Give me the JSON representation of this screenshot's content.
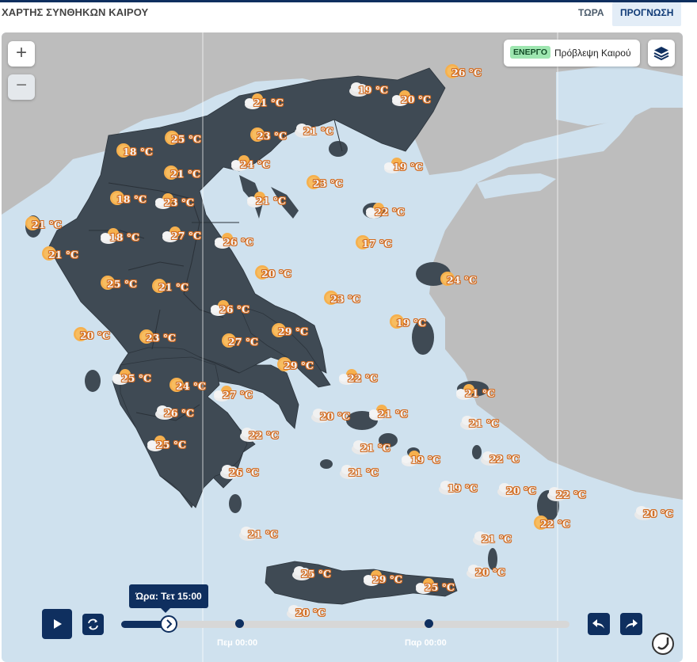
{
  "header": {
    "title": "ΧΑΡΤΗΣ ΣΥΝΘΗΚΩΝ ΚΑΙΡΟΥ",
    "tabs": [
      {
        "label": "ΤΩΡΑ",
        "active": false
      },
      {
        "label": "ΠΡΟΓΝΩΣΗ",
        "active": true
      }
    ]
  },
  "map_controls": {
    "zoom_in": "+",
    "zoom_out": "−",
    "layer": {
      "status_badge": "ΕΝΕΡΓΟ",
      "name": "Πρόβλεψη Καιρού"
    },
    "layers_icon": "layers-icon"
  },
  "markers": [
    {
      "temp": "26 °C",
      "icon": "sun"
    },
    {
      "temp": "19 °C",
      "icon": "cloud"
    },
    {
      "temp": "20 °C",
      "icon": "partly-cloudy"
    },
    {
      "temp": "21 °C",
      "icon": "partly-cloudy"
    },
    {
      "temp": "21 °C",
      "icon": "cloud"
    },
    {
      "temp": "23 °C",
      "icon": "sun"
    },
    {
      "temp": "25 °C",
      "icon": "sun"
    },
    {
      "temp": "18 °C",
      "icon": "sun"
    },
    {
      "temp": "21 °C",
      "icon": "sun"
    },
    {
      "temp": "24 °C",
      "icon": "partly-cloudy"
    },
    {
      "temp": "19 °C",
      "icon": "partly-cloudy"
    },
    {
      "temp": "23 °C",
      "icon": "sun"
    },
    {
      "temp": "18 °C",
      "icon": "sun"
    },
    {
      "temp": "23 °C",
      "icon": "partly-cloudy"
    },
    {
      "temp": "21 °C",
      "icon": "partly-cloudy"
    },
    {
      "temp": "22 °C",
      "icon": "partly-cloudy"
    },
    {
      "temp": "21 °C",
      "icon": "sun"
    },
    {
      "temp": "18 °C",
      "icon": "partly-cloudy"
    },
    {
      "temp": "27 °C",
      "icon": "partly-cloudy"
    },
    {
      "temp": "26 °C",
      "icon": "partly-cloudy"
    },
    {
      "temp": "17 °C",
      "icon": "sun"
    },
    {
      "temp": "21 °C",
      "icon": "sun"
    },
    {
      "temp": "20 °C",
      "icon": "sun"
    },
    {
      "temp": "24 °C",
      "icon": "sun"
    },
    {
      "temp": "25 °C",
      "icon": "sun"
    },
    {
      "temp": "21 °C",
      "icon": "sun"
    },
    {
      "temp": "23 °C",
      "icon": "sun"
    },
    {
      "temp": "26 °C",
      "icon": "partly-cloudy"
    },
    {
      "temp": "19 °C",
      "icon": "sun"
    },
    {
      "temp": "20 °C",
      "icon": "sun"
    },
    {
      "temp": "23 °C",
      "icon": "sun"
    },
    {
      "temp": "27 °C",
      "icon": "sun"
    },
    {
      "temp": "29 °C",
      "icon": "sun"
    },
    {
      "temp": "29 °C",
      "icon": "sun"
    },
    {
      "temp": "22 °C",
      "icon": "partly-cloudy"
    },
    {
      "temp": "25 °C",
      "icon": "partly-cloudy"
    },
    {
      "temp": "24 °C",
      "icon": "sun"
    },
    {
      "temp": "21 °C",
      "icon": "partly-cloudy"
    },
    {
      "temp": "27 °C",
      "icon": "partly-cloudy"
    },
    {
      "temp": "26 °C",
      "icon": "cloud"
    },
    {
      "temp": "20 °C",
      "icon": "cloud"
    },
    {
      "temp": "21 °C",
      "icon": "partly-cloudy"
    },
    {
      "temp": "21 °C",
      "icon": "cloud"
    },
    {
      "temp": "22 °C",
      "icon": "cloud"
    },
    {
      "temp": "25 °C",
      "icon": "partly-cloudy"
    },
    {
      "temp": "21 °C",
      "icon": "cloud"
    },
    {
      "temp": "19 °C",
      "icon": "partly-cloudy"
    },
    {
      "temp": "22 °C",
      "icon": "cloud"
    },
    {
      "temp": "21 °C",
      "icon": "cloud"
    },
    {
      "temp": "26 °C",
      "icon": "cloud"
    },
    {
      "temp": "19 °C",
      "icon": "cloud"
    },
    {
      "temp": "20 °C",
      "icon": "cloud"
    },
    {
      "temp": "22 °C",
      "icon": "cloud"
    },
    {
      "temp": "20 °C",
      "icon": "cloud"
    },
    {
      "temp": "22 °C",
      "icon": "sun"
    },
    {
      "temp": "21 °C",
      "icon": "cloud"
    },
    {
      "temp": "21 °C",
      "icon": "cloud"
    },
    {
      "temp": "20 °C",
      "icon": "cloud"
    },
    {
      "temp": "25 °C",
      "icon": "cloud"
    },
    {
      "temp": "29 °C",
      "icon": "partly-cloudy"
    },
    {
      "temp": "25 °C",
      "icon": "partly-cloudy"
    },
    {
      "temp": "20 °C",
      "icon": "cloud"
    }
  ],
  "timeline": {
    "tooltip": "Ώρα: Τετ 15:00",
    "ticks": [
      "Πεμ 00:00",
      "Παρ 00:00"
    ]
  },
  "colors": {
    "land_greece": "#3f4a54",
    "land_other": "#bfbfbf",
    "sea": "#cfe1ee",
    "accent": "#0f2f5f",
    "temp_outline": "#d26a1e"
  }
}
